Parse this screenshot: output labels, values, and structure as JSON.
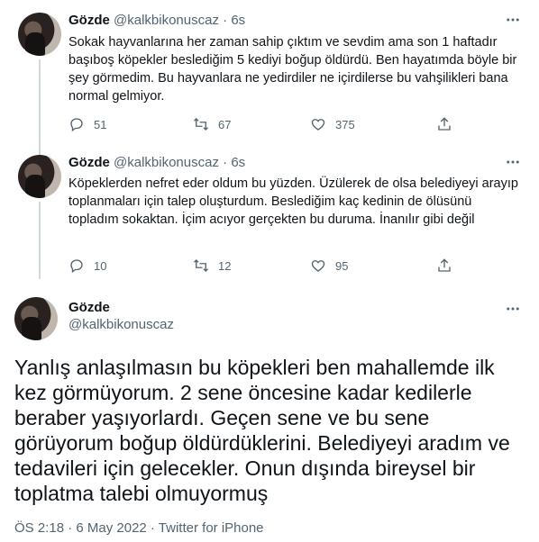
{
  "tweets": [
    {
      "name": "Gözde",
      "handle": "@kalkbikonuscaz",
      "sep": "·",
      "time": "6s",
      "text": "Sokak hayvanlarına her zaman sahip çıktım ve sevdim ama son 1 haftadır başıboş köpekler beslediğim 5 kediyi boğup öldürdü. Ben hayatımda böyle bir şey görmedim. Bu hayvanlara ne yedirdiler ne içirdilerse bu vahşilikleri bana normal gelmiyor.",
      "replies": "51",
      "retweets": "67",
      "likes": "375"
    },
    {
      "name": "Gözde",
      "handle": "@kalkbikonuscaz",
      "sep": "·",
      "time": "6s",
      "text": "Köpeklerden nefret eder oldum bu yüzden. Üzülerek de olsa belediyeyi arayıp toplanmaları için talep oluşturdum. Beslediğim kaç kedinin de ölüsünü topladım sokaktan. İçim acıyor gerçekten bu duruma. İnanılır gibi değil",
      "replies": "10",
      "retweets": "12",
      "likes": "95"
    }
  ],
  "main": {
    "name": "Gözde",
    "handle": "@kalkbikonuscaz",
    "text": "Yanlış anlaşılmasın bu köpekleri ben mahallemde ilk kez görmüyorum. 2 sene öncesine kadar kedilerle beraber yaşıyorlardı. Geçen sene ve bu sene görüyorum boğup öldürdüklerini. Belediyeyi aradım ve tedavileri için gelecekler. Onun dışında bireysel bir toplatma talebi olmuyormuş",
    "meta": "ÖS 2:18 · 6 May 2022 · Twitter for iPhone"
  },
  "icons": {
    "more": "more-dots-icon",
    "reply": "reply-icon",
    "retweet": "retweet-icon",
    "like": "heart-icon",
    "share": "share-icon"
  },
  "colors": {
    "text": "#0f1419",
    "secondary": "#536471",
    "thread_line": "#cfd9de"
  }
}
